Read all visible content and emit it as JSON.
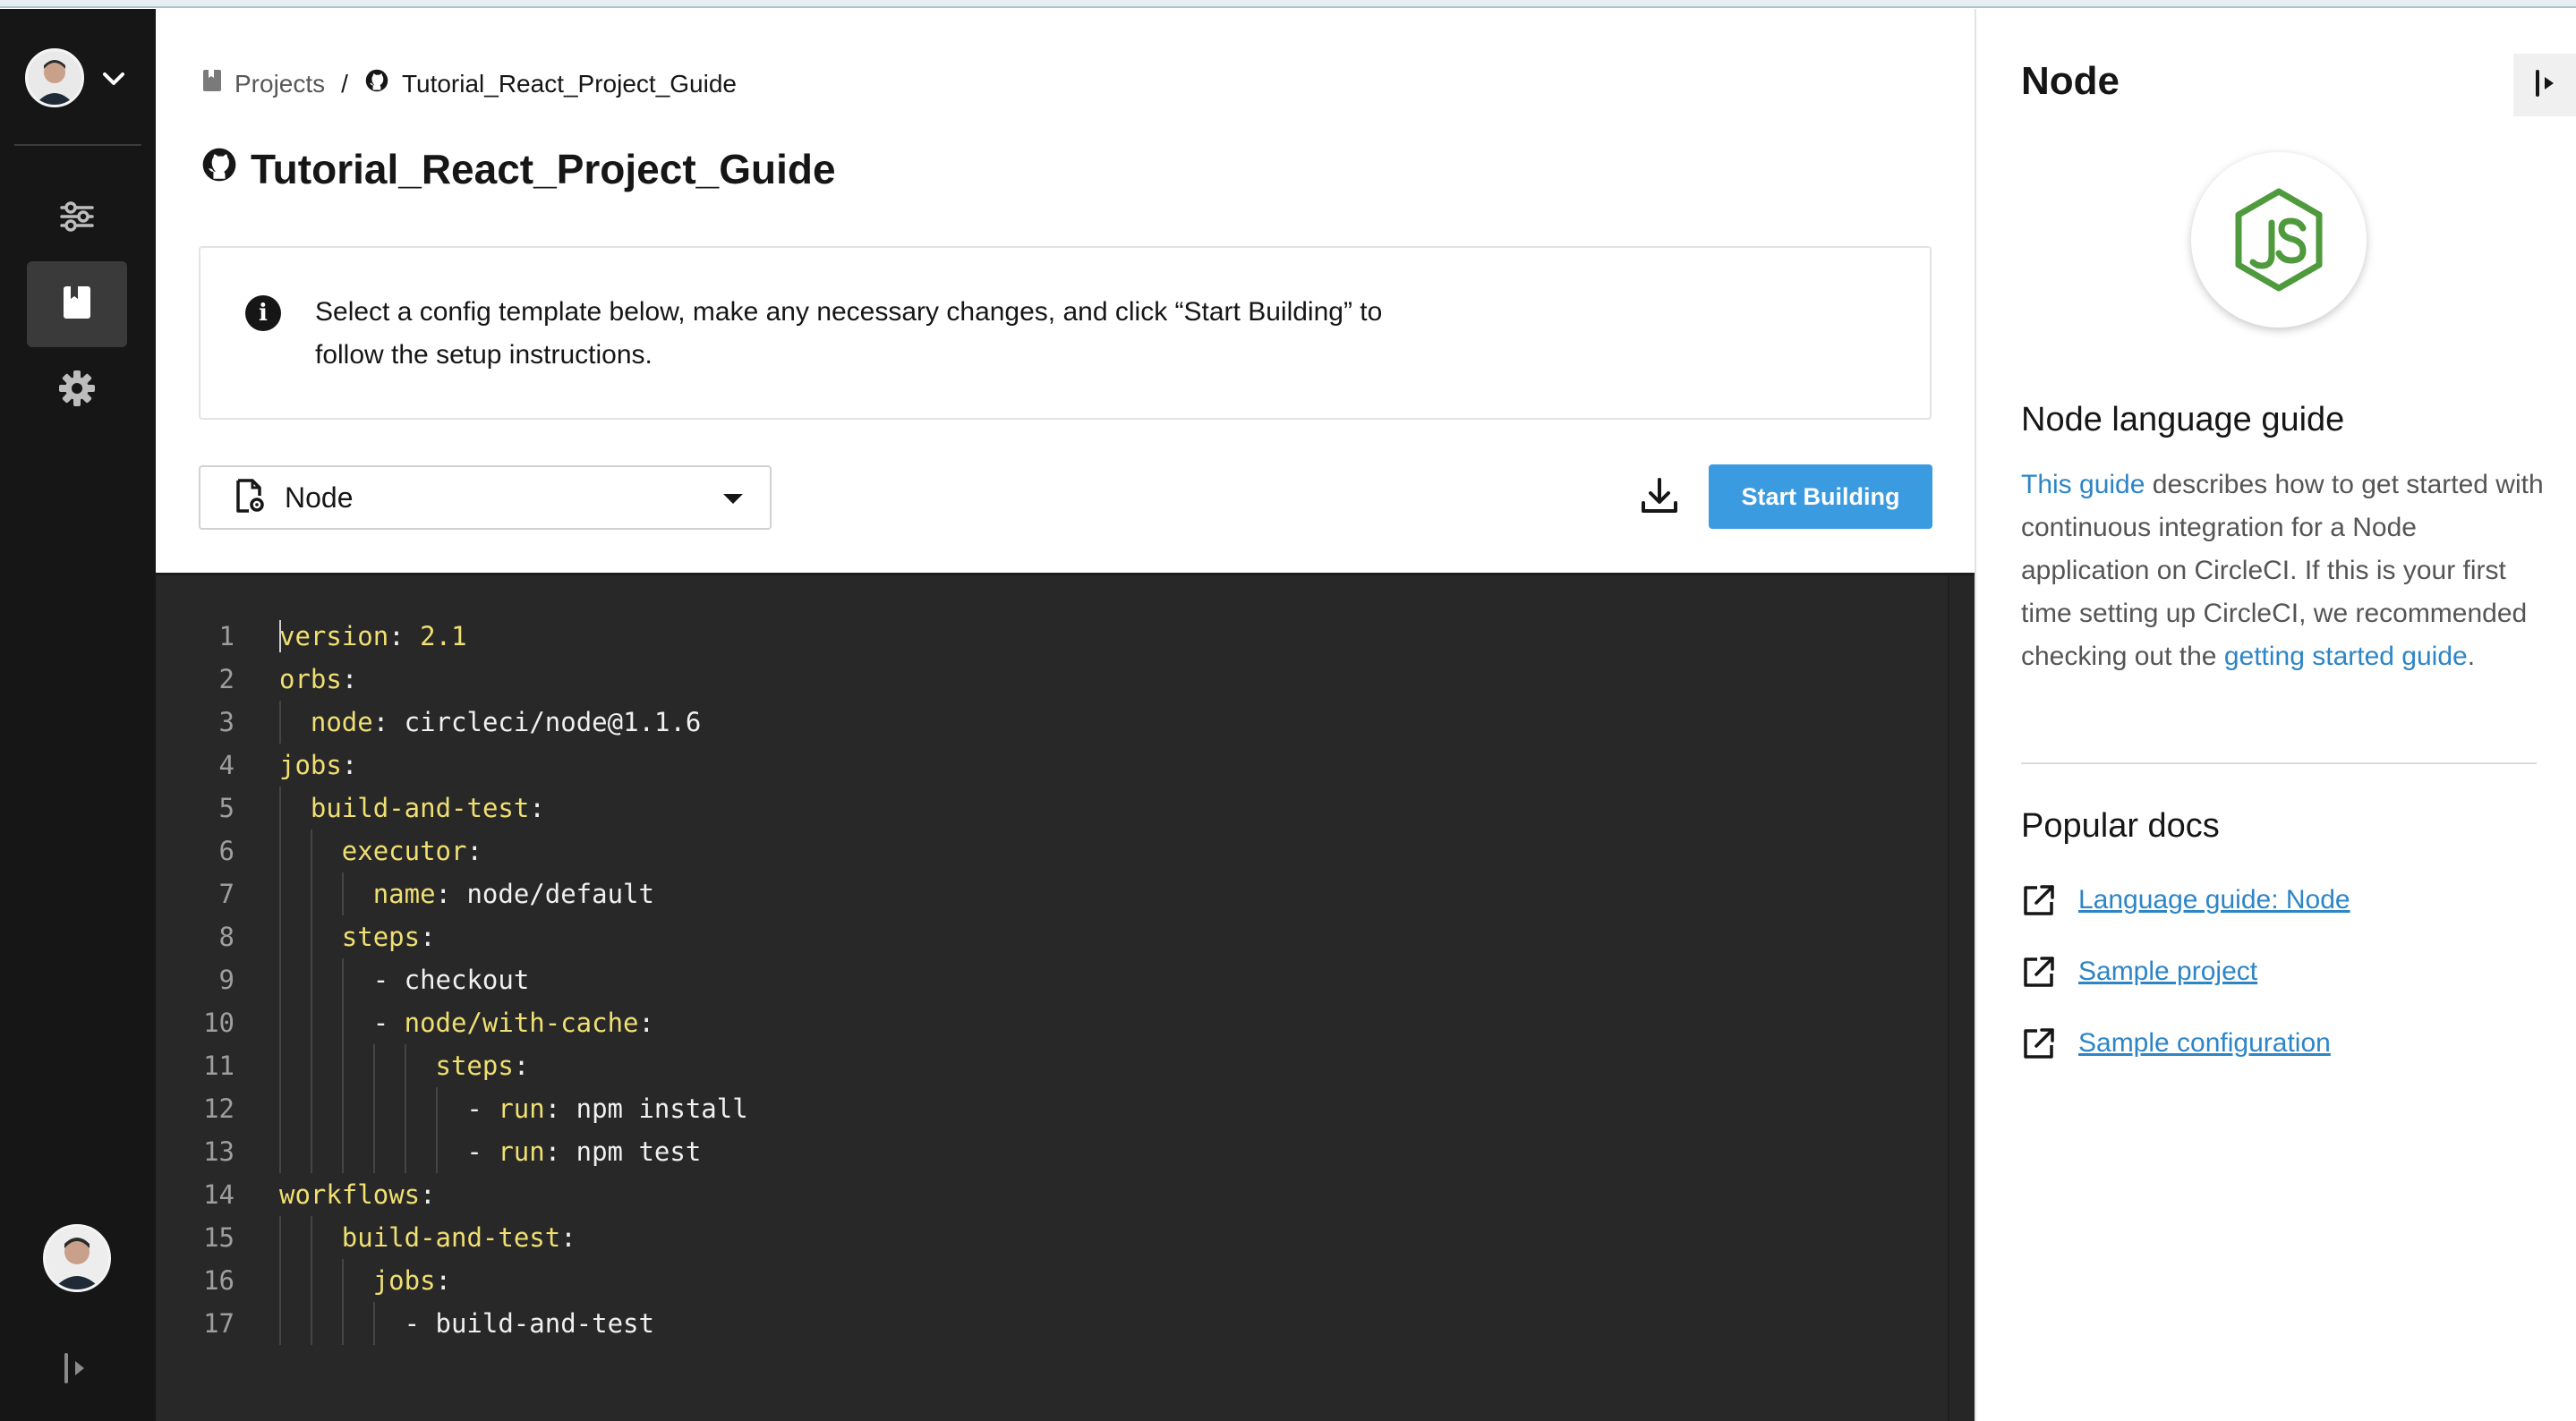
{
  "nav": {
    "items": [
      {
        "name": "settings-sliders",
        "icon": "sliders-icon"
      },
      {
        "name": "projects",
        "icon": "book-icon",
        "active": true
      },
      {
        "name": "settings",
        "icon": "gear-icon"
      }
    ]
  },
  "breadcrumb": {
    "projects_label": "Projects",
    "separator": "/",
    "repo_label": "Tutorial_React_Project_Guide"
  },
  "page": {
    "title": "Tutorial_React_Project_Guide"
  },
  "info": {
    "icon": "info-icon",
    "line1": "Select a config template below, make any necessary changes, and click “Start Building” to",
    "line2": "follow the setup instructions."
  },
  "template_select": {
    "selected": "Node"
  },
  "actions": {
    "download_icon": "download-icon",
    "start_label": "Start Building",
    "accent": "#3b9be0"
  },
  "editor": {
    "lines": [
      {
        "n": "1",
        "indent": 0,
        "key": "version",
        "value": " 2.1",
        "dash": false
      },
      {
        "n": "2",
        "indent": 0,
        "key": "orbs",
        "value": "",
        "dash": false
      },
      {
        "n": "3",
        "indent": 1,
        "key": "node",
        "value": " circleci/node@1.1.6",
        "dash": false
      },
      {
        "n": "4",
        "indent": 0,
        "key": "jobs",
        "value": "",
        "dash": false
      },
      {
        "n": "5",
        "indent": 1,
        "key": "build-and-test",
        "value": "",
        "dash": false
      },
      {
        "n": "6",
        "indent": 2,
        "key": "executor",
        "value": "",
        "dash": false
      },
      {
        "n": "7",
        "indent": 3,
        "key": "name",
        "value": " node/default",
        "dash": false
      },
      {
        "n": "8",
        "indent": 2,
        "key": "steps",
        "value": "",
        "dash": false
      },
      {
        "n": "9",
        "indent": 3,
        "key": "",
        "value": "- checkout",
        "dash": false
      },
      {
        "n": "10",
        "indent": 3,
        "key": "node/with-cache",
        "value": "",
        "dash": true
      },
      {
        "n": "11",
        "indent": 5,
        "key": "steps",
        "value": "",
        "dash": false
      },
      {
        "n": "12",
        "indent": 6,
        "key": "run",
        "value": " npm install",
        "dash": true
      },
      {
        "n": "13",
        "indent": 6,
        "key": "run",
        "value": " npm test",
        "dash": true
      },
      {
        "n": "14",
        "indent": 0,
        "key": "workflows",
        "value": "",
        "dash": false
      },
      {
        "n": "15",
        "indent": 2,
        "key": "build-and-test",
        "value": "",
        "dash": false
      },
      {
        "n": "16",
        "indent": 3,
        "key": "jobs",
        "value": "",
        "dash": false
      },
      {
        "n": "17",
        "indent": 4,
        "key": "",
        "value": "- build-and-test",
        "dash": false
      }
    ],
    "key_color": "#f0df72",
    "background": "#282828"
  },
  "panel": {
    "title": "Node",
    "logo": "nodejs-logo",
    "guide_heading": "Node language guide",
    "guide_link1": "This guide",
    "guide_text1": " describes how to get started with continuous integration for a Node application on CircleCI. If this is your first time setting up CircleCI, we recommended checking out the ",
    "guide_link2": "getting started guide",
    "guide_text2": ".",
    "docs_heading": "Popular docs",
    "docs": [
      {
        "label": "Language guide: Node"
      },
      {
        "label": "Sample project"
      },
      {
        "label": "Sample configuration"
      }
    ],
    "link_color": "#2d85c6"
  }
}
